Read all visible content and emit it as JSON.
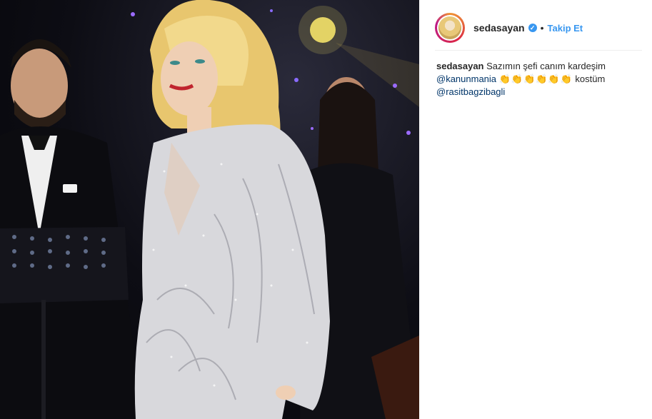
{
  "post": {
    "username": "sedasayan",
    "verified_icon": "verified-badge-icon",
    "separator": "•",
    "follow_label": "Takip Et"
  },
  "caption": {
    "username": "sedasayan",
    "text": "Sazımın şefi canım kardeşim",
    "mention1": "@kanunmania",
    "emojis": "👏👏👏👏👏👏",
    "text2": "kostüm",
    "mention2": "@rasitbagzibagli"
  },
  "colors": {
    "link": "#3897f0",
    "mention": "#003569",
    "text": "#262626"
  }
}
